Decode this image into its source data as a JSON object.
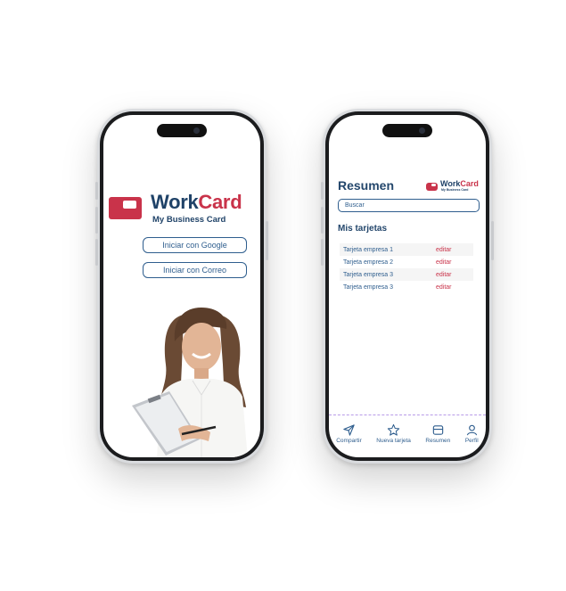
{
  "login": {
    "logo_work": "Work",
    "logo_card": "Card",
    "logo_tagline": "My Business Card",
    "google_button": "Iniciar con Google",
    "email_button": "Iniciar con Correo"
  },
  "summary": {
    "title": "Resumen",
    "logo_work": "Work",
    "logo_card": "Card",
    "logo_tagline": "My Business Card",
    "search_placeholder": "Buscar",
    "section_title": "Mis tarjetas",
    "cards": [
      {
        "name": "Tarjeta empresa 1",
        "action": "editar"
      },
      {
        "name": "Tarjeta empresa 2",
        "action": "editar"
      },
      {
        "name": "Tarjeta empresa 3",
        "action": "editar"
      },
      {
        "name": "Tarjeta empresa 3",
        "action": "editar"
      }
    ],
    "tabs": [
      {
        "label": "Compartir",
        "icon": "send-icon"
      },
      {
        "label": "Nueva tarjeta",
        "icon": "star-icon"
      },
      {
        "label": "Resumen",
        "icon": "card-icon"
      },
      {
        "label": "Perfil",
        "icon": "user-icon"
      }
    ]
  },
  "colors": {
    "brand_red": "#c9334a",
    "brand_blue": "#1f4268",
    "accent_purple": "#b89be8"
  }
}
